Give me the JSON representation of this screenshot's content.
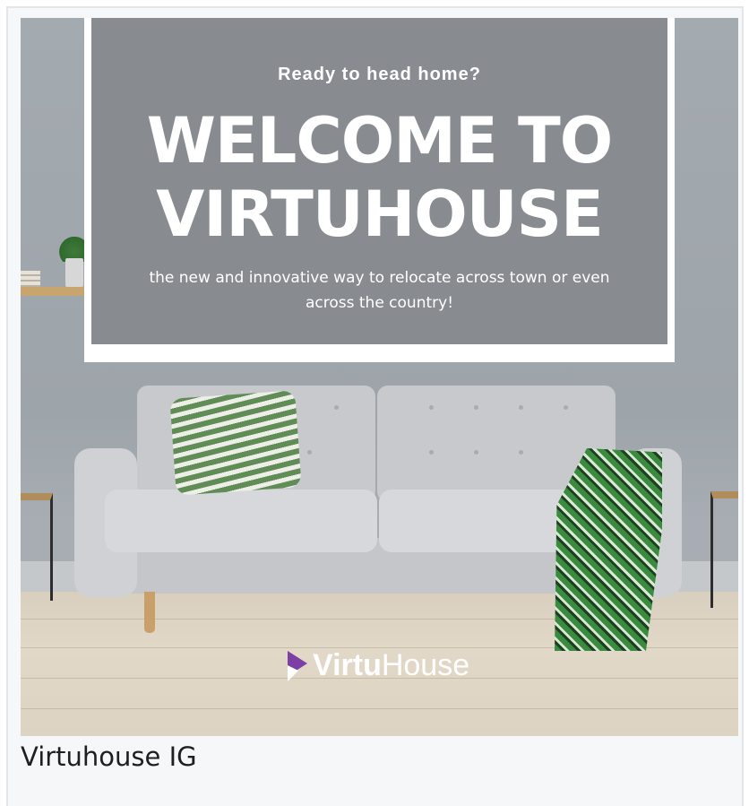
{
  "post": {
    "tagline": "Ready to head home?",
    "headline_line1": "WELCOME TO",
    "headline_line2": "VIRTUHOUSE",
    "subtext": "the new and innovative way to relocate across town or even across the country!",
    "logo_bold": "Virtu",
    "logo_light": "House",
    "logo_icon": "play-mark-icon"
  },
  "caption": "Virtuhouse IG",
  "colors": {
    "logo_mark": "#7b3fa6",
    "frame": "#ffffff",
    "wall": "#9da4aa"
  }
}
